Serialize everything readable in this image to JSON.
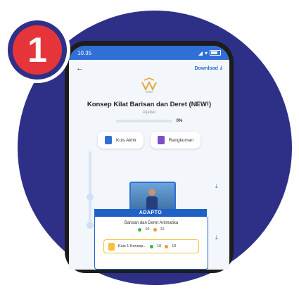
{
  "badge": {
    "number": "1"
  },
  "status_bar": {
    "time": "10.35"
  },
  "top_bar": {
    "download_label": "Download"
  },
  "header": {
    "title": "Konsep Kilat Barisan dan Deret (NEW!)",
    "subtitle": "Aljabar",
    "progress_percent": "0%",
    "progress_value": 0
  },
  "actions": [
    {
      "label": "Kuis Akhir",
      "icon": "quiz-icon",
      "color": "#2f6fd6"
    },
    {
      "label": "Rangkuman",
      "icon": "summary-icon",
      "color": "#7b4fc9"
    }
  ],
  "lesson": {
    "banner": "ADAPTO",
    "title": "Barisan dan Deret Aritmatika",
    "stat_green": "10",
    "stat_orange": "10",
    "quiz_label": "Kuis 1 Konsep...",
    "quiz_green": "10",
    "quiz_orange": "10"
  },
  "colors": {
    "circle_bg": "#2e3088",
    "badge_red": "#e6353a",
    "accent_blue": "#2f6fd6"
  }
}
